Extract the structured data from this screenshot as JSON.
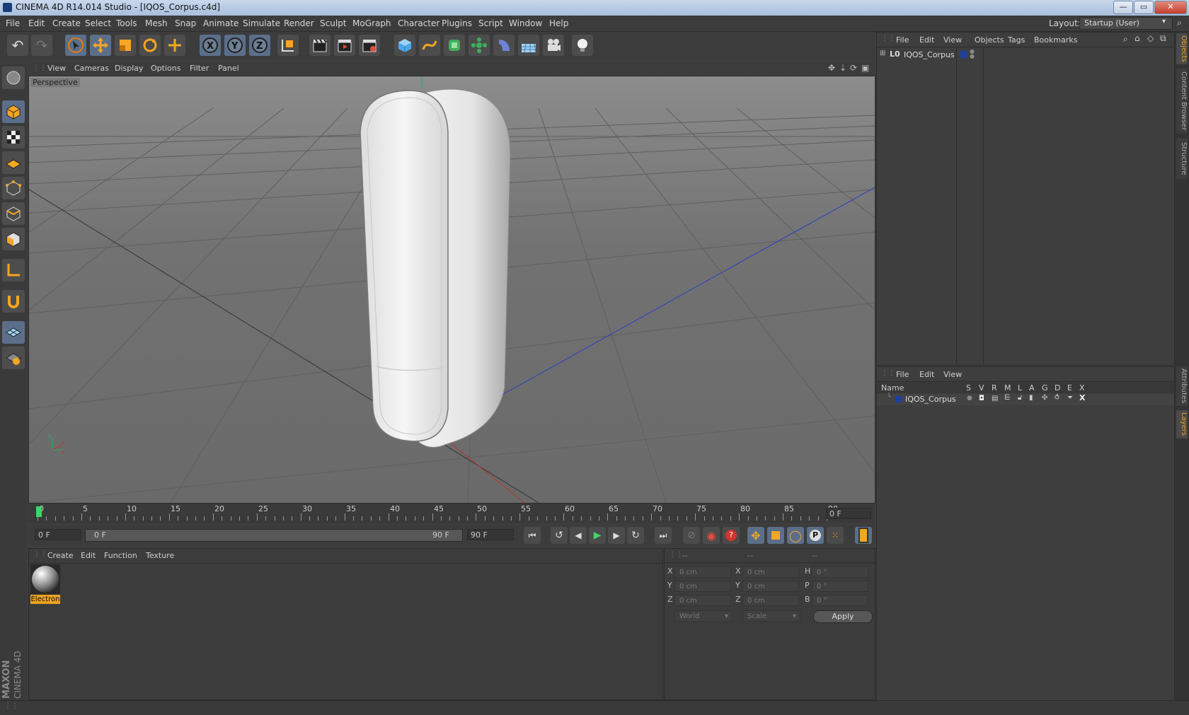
{
  "window": {
    "title": "CINEMA 4D R14.014 Studio - [IQOS_Corpus.c4d]",
    "minimize": "—",
    "maximize": "▭",
    "close": "✕"
  },
  "menubar": {
    "items": [
      "File",
      "Edit",
      "Create",
      "Select",
      "Tools",
      "Mesh",
      "Snap",
      "Animate",
      "Simulate",
      "Render",
      "Sculpt",
      "MoGraph",
      "Character",
      "Plugins",
      "Script",
      "Window",
      "Help"
    ],
    "layout_label": "Layout:",
    "layout_value": "Startup (User)"
  },
  "viewport": {
    "menu": [
      "View",
      "Cameras",
      "Display",
      "Options",
      "Filter",
      "Panel"
    ],
    "label": "Perspective"
  },
  "timeline": {
    "ticks": [
      "0",
      "5",
      "10",
      "15",
      "20",
      "25",
      "30",
      "35",
      "40",
      "45",
      "50",
      "55",
      "60",
      "65",
      "70",
      "75",
      "80",
      "85",
      "90"
    ],
    "current_frame": "0 F",
    "start_field": "0 F",
    "range_start": "0 F",
    "range_end": "90 F",
    "end_field": "90 F"
  },
  "material_manager": {
    "menu": [
      "Create",
      "Edit",
      "Function",
      "Texture"
    ],
    "materials": [
      {
        "name": "Electron"
      }
    ]
  },
  "coordinates": {
    "header": [
      "--",
      "--",
      "--"
    ],
    "rows": [
      {
        "a": "X",
        "a_val": "0 cm",
        "b": "X",
        "b_val": "0 cm",
        "c": "H",
        "c_val": "0 °"
      },
      {
        "a": "Y",
        "a_val": "0 cm",
        "b": "Y",
        "b_val": "0 cm",
        "c": "P",
        "c_val": "0 °"
      },
      {
        "a": "Z",
        "a_val": "0 cm",
        "b": "Z",
        "b_val": "0 cm",
        "c": "B",
        "c_val": "0 °"
      }
    ],
    "space": "World",
    "mode": "Scale",
    "apply": "Apply"
  },
  "object_manager": {
    "menu": [
      "File",
      "Edit",
      "View",
      "Objects",
      "Tags",
      "Bookmarks"
    ],
    "objects": [
      {
        "name": "IQOS_Corpus",
        "layer_color": "#1d3fa3"
      }
    ]
  },
  "layer_manager": {
    "menu": [
      "File",
      "Edit",
      "View"
    ],
    "columns": [
      "Name",
      "S",
      "V",
      "R",
      "M",
      "L",
      "A",
      "G",
      "D",
      "E",
      "X"
    ],
    "layers": [
      {
        "name": "IQOS_Corpus",
        "color": "#1d3fa3"
      }
    ]
  },
  "side_tabs": [
    {
      "label": "Objects",
      "active": true
    },
    {
      "label": "Content Browser",
      "active": false
    },
    {
      "label": "Structure",
      "active": false
    },
    {
      "label": "Attributes",
      "active": false
    },
    {
      "label": "Layers",
      "active": true
    }
  ],
  "branding": {
    "line1": "MAXON",
    "line2": "CINEMA 4D"
  },
  "colors": {
    "accent": "#e8a21f",
    "highlight": "#5b6f8a",
    "x_axis": "#c0392b",
    "y_axis": "#27ae60",
    "z_axis": "#2c3fbf"
  }
}
